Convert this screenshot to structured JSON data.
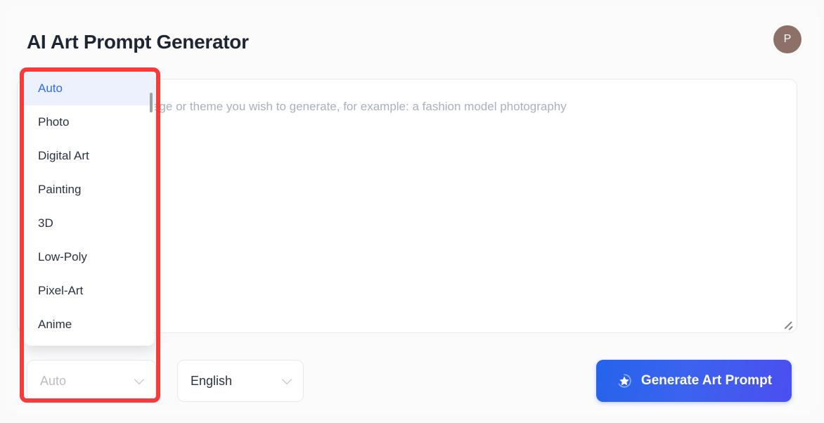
{
  "header": {
    "title": "AI Art Prompt Generator",
    "avatar_initial": "P"
  },
  "prompt": {
    "placeholder": "Please describe the image or theme you wish to generate, for example: a fashion model photography",
    "value": ""
  },
  "controls": {
    "style_select": {
      "label": "Auto",
      "is_placeholder": true
    },
    "language_select": {
      "label": "English"
    },
    "generate_button": {
      "label": "Generate Art Prompt",
      "icon": "magic-star-icon"
    }
  },
  "style_dropdown": {
    "open": true,
    "selected": "Auto",
    "items": [
      {
        "label": "Auto"
      },
      {
        "label": "Photo"
      },
      {
        "label": "Digital Art"
      },
      {
        "label": "Painting"
      },
      {
        "label": "3D"
      },
      {
        "label": "Low-Poly"
      },
      {
        "label": "Pixel-Art"
      },
      {
        "label": "Anime"
      }
    ]
  },
  "colors": {
    "accent": "#2563eb",
    "accent_end": "#4b4fef",
    "highlight": "#f93a3a",
    "selected_bg": "#edf1fd",
    "selected_text": "#2f6cf0",
    "avatar_bg": "#8d7068",
    "page_bg": "#fafafb"
  }
}
